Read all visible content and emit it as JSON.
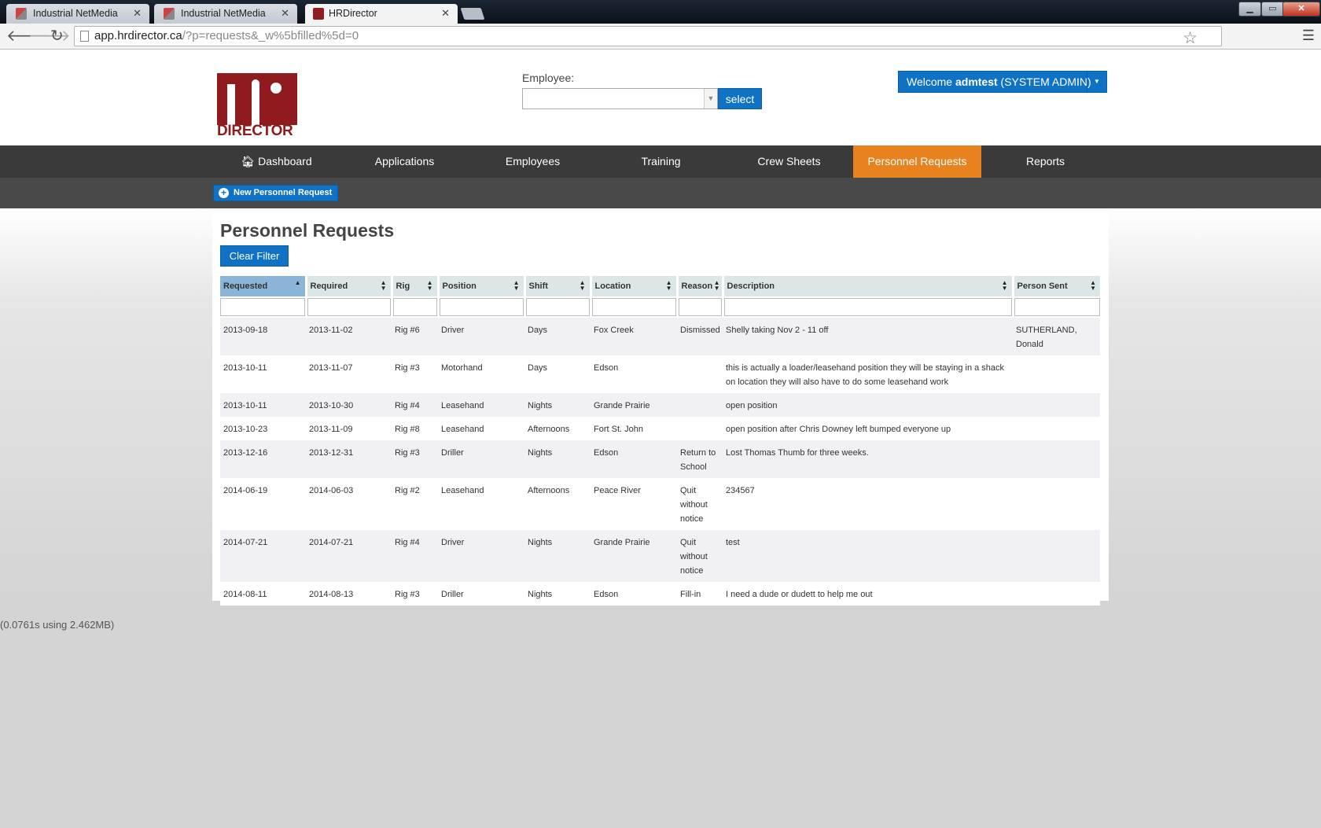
{
  "browser": {
    "tabs": [
      {
        "title": "Industrial NetMedia",
        "active": false,
        "icon": "book-icon"
      },
      {
        "title": "Industrial NetMedia",
        "active": false,
        "icon": "book-icon"
      },
      {
        "title": "HRDirector",
        "active": true,
        "icon": "hrdirector-icon"
      }
    ],
    "url_host": "app.hrdirector.ca",
    "url_path": "/?p=requests&_w%5bfilled%5d=0",
    "window_controls": {
      "minimize": "▁",
      "restore": "▭",
      "close": "✕"
    }
  },
  "header": {
    "logo_lettering": "HR DIRECTOR",
    "logo_text": "DIRECTOR",
    "employee_label": "Employee:",
    "employee_value": "",
    "select_button": "select",
    "welcome_prefix": "Welcome ",
    "welcome_user": "admtest",
    "welcome_role": " (SYSTEM ADMIN)"
  },
  "nav": {
    "items": [
      {
        "label": "Dashboard",
        "icon": "home-icon",
        "active": false
      },
      {
        "label": "Applications",
        "active": false
      },
      {
        "label": "Employees",
        "active": false
      },
      {
        "label": "Training",
        "active": false
      },
      {
        "label": "Crew Sheets",
        "active": false
      },
      {
        "label": "Personnel Requests",
        "active": true
      },
      {
        "label": "Reports",
        "active": false
      }
    ]
  },
  "subbar": {
    "new_request": "New Personnel Request"
  },
  "main": {
    "title": "Personnel Requests",
    "clear_filter": "Clear Filter",
    "table": {
      "columns": [
        {
          "label": "Requested",
          "sorted": "asc"
        },
        {
          "label": "Required"
        },
        {
          "label": "Rig"
        },
        {
          "label": "Position"
        },
        {
          "label": "Shift"
        },
        {
          "label": "Location"
        },
        {
          "label": "Reason"
        },
        {
          "label": "Description"
        },
        {
          "label": "Person Sent"
        }
      ],
      "rows": [
        [
          "2013-09-18",
          "2013-11-02",
          "Rig #6",
          "Driver",
          "Days",
          "Fox Creek",
          "Dismissed",
          "Shelly taking Nov 2 - 11 off",
          "SUTHERLAND, Donald"
        ],
        [
          "2013-10-11",
          "2013-11-07",
          "Rig #3",
          "Motorhand",
          "Days",
          "Edson",
          "",
          "this is actually a loader/leasehand position they will be staying in a shack on location they will also have to do some leasehand work",
          ""
        ],
        [
          "2013-10-11",
          "2013-10-30",
          "Rig #4",
          "Leasehand",
          "Nights",
          "Grande Prairie",
          "",
          "open position",
          ""
        ],
        [
          "2013-10-23",
          "2013-11-09",
          "Rig #8",
          "Leasehand",
          "Afternoons",
          "Fort St. John",
          "",
          "open position after Chris Downey left bumped everyone up",
          ""
        ],
        [
          "2013-12-16",
          "2013-12-31",
          "Rig #3",
          "Driller",
          "Nights",
          "Edson",
          "Return to School",
          "Lost Thomas Thumb for three weeks.",
          ""
        ],
        [
          "2014-06-19",
          "2014-06-03",
          "Rig #2",
          "Leasehand",
          "Afternoons",
          "Peace River",
          "Quit without notice",
          "234567",
          ""
        ],
        [
          "2014-07-21",
          "2014-07-21",
          "Rig #4",
          "Driver",
          "Nights",
          "Grande Prairie",
          "Quit without notice",
          "test",
          ""
        ],
        [
          "2014-08-11",
          "2014-08-13",
          "Rig #3",
          "Driller",
          "Nights",
          "Edson",
          "Fill-in",
          "I need a dude or dudett to help me out",
          ""
        ]
      ]
    }
  },
  "footer": {
    "timing": "(0.0761s using 2.462MB)"
  },
  "colors": {
    "accent": "#0f72c5",
    "nav_active": "#e8821e",
    "brand": "#8f1b1e",
    "nav_bg": "#3a3a3a"
  }
}
